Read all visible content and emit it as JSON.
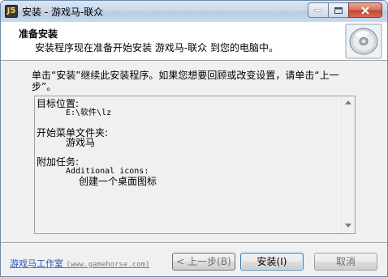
{
  "window": {
    "title": "安装 - 游戏马-联众",
    "app_icon_text": "J5"
  },
  "header": {
    "title": "准备安装",
    "subtitle": "安装程序现在准备开始安装 游戏马-联众 到您的电脑中。",
    "icon": "disc-icon"
  },
  "intro_text": "单击“安装”继续此安装程序。如果您想要回顾或改变设置，请单击“上一步”。",
  "memo": {
    "dest_label": "目标位置:",
    "dest_value": "E:\\软件\\lz",
    "menu_label": "开始菜单文件夹:",
    "menu_value": "游戏马",
    "tasks_label": "附加任务:",
    "tasks_group": "Additional icons:",
    "tasks_item": "创建一个桌面图标"
  },
  "footer": {
    "link_cn": "游戏马工作室",
    "link_url": "(www.gamehorse.com)",
    "back_label": "< 上一步(B)",
    "install_label": "安装(I)",
    "cancel_label": "取消"
  },
  "colors": {
    "link": "#2a52b8",
    "window_bg": "#f0f0f0",
    "close_button": "#c1462f"
  }
}
